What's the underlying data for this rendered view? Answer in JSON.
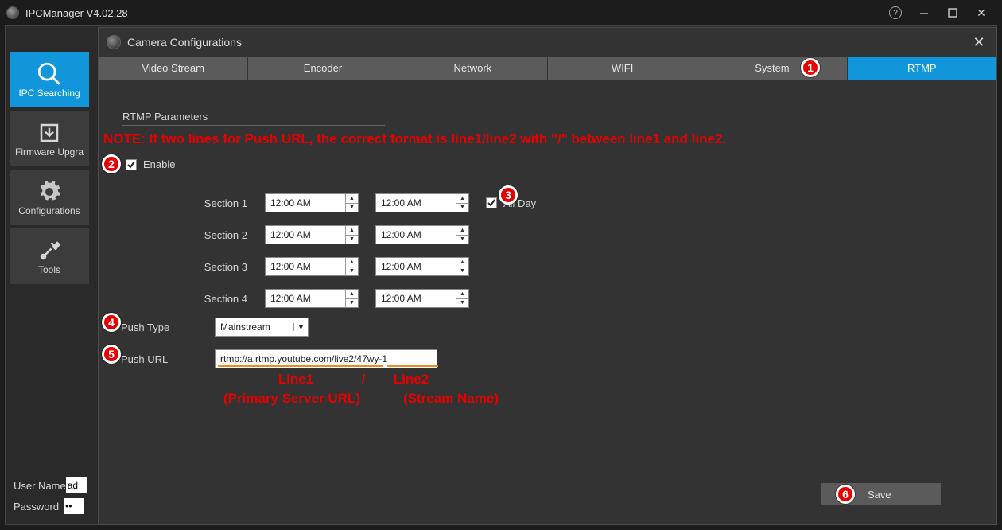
{
  "title": "IPCManager V4.02.28",
  "sidebar": {
    "items": [
      {
        "label": "IPC Searching",
        "active": true
      },
      {
        "label": "Firmware Upgra",
        "active": false
      },
      {
        "label": "Configurations",
        "active": false
      },
      {
        "label": "Tools",
        "active": false
      }
    ]
  },
  "bottom": {
    "user_label": "User Name",
    "user_value": "ad",
    "pass_label": "Password",
    "pass_value": "••"
  },
  "modal": {
    "title": "Camera Configurations",
    "tabs": [
      "Video Stream",
      "Encoder",
      "Network",
      "WIFI",
      "System",
      "RTMP"
    ],
    "active_tab": 5,
    "group_label": "RTMP Parameters",
    "note": "NOTE: If two lines for Push URL, the correct format is line1/line2 with \"/\" between line1 and line2.",
    "enable_label": "Enable",
    "enable_checked": true,
    "sections": [
      {
        "label": "Section 1",
        "from": "12:00 AM",
        "to": "12:00 AM"
      },
      {
        "label": "Section 2",
        "from": "12:00 AM",
        "to": "12:00 AM"
      },
      {
        "label": "Section 3",
        "from": "12:00 AM",
        "to": "12:00 AM"
      },
      {
        "label": "Section 4",
        "from": "12:00 AM",
        "to": "12:00 AM"
      }
    ],
    "allday_label": "All Day",
    "allday_checked": true,
    "push_type_label": "Push Type",
    "push_type_value": "Mainstream",
    "push_url_label": "Push URL",
    "push_url_value": "rtmp://a.rtmp.youtube.com/live2/47wy-1",
    "annotations": {
      "line1": "Line1",
      "sep": "/",
      "line2": "Line2",
      "p1": "(Primary Server URL)",
      "p2": "(Stream Name)"
    },
    "save_label": "Save"
  }
}
